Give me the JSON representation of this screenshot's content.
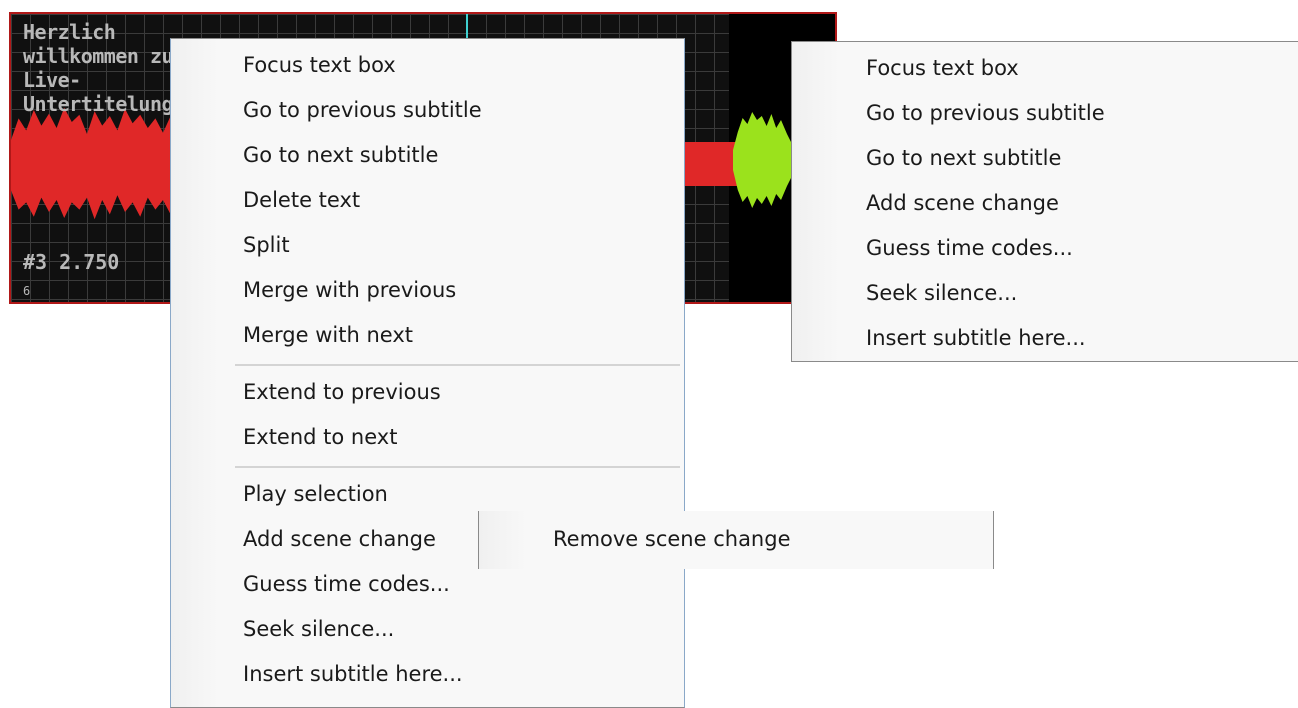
{
  "waveform": {
    "caption": "Herzlich willkommen zur Live-Untertitelung",
    "subtitle_number": "#3  2.750",
    "tick_label": "6"
  },
  "main_menu": {
    "items": [
      "Focus text box",
      "Go to previous subtitle",
      "Go to next subtitle",
      "Delete text",
      "Split",
      "Merge with previous",
      "Merge with next",
      "Extend to previous",
      "Extend to next",
      "Play selection",
      "Add scene change",
      "Guess time codes...",
      "Seek silence...",
      "Insert subtitle here..."
    ]
  },
  "right_menu": {
    "items": [
      "Focus text box",
      "Go to previous subtitle",
      "Go to next subtitle",
      "Add scene change",
      "Guess time codes...",
      "Seek silence...",
      "Insert subtitle here..."
    ]
  },
  "sub_menu": {
    "items": [
      "Remove scene change"
    ]
  },
  "colors": {
    "waveform_red": "#e02828",
    "waveform_green": "#9be21c",
    "waveform_border": "#b01818"
  }
}
